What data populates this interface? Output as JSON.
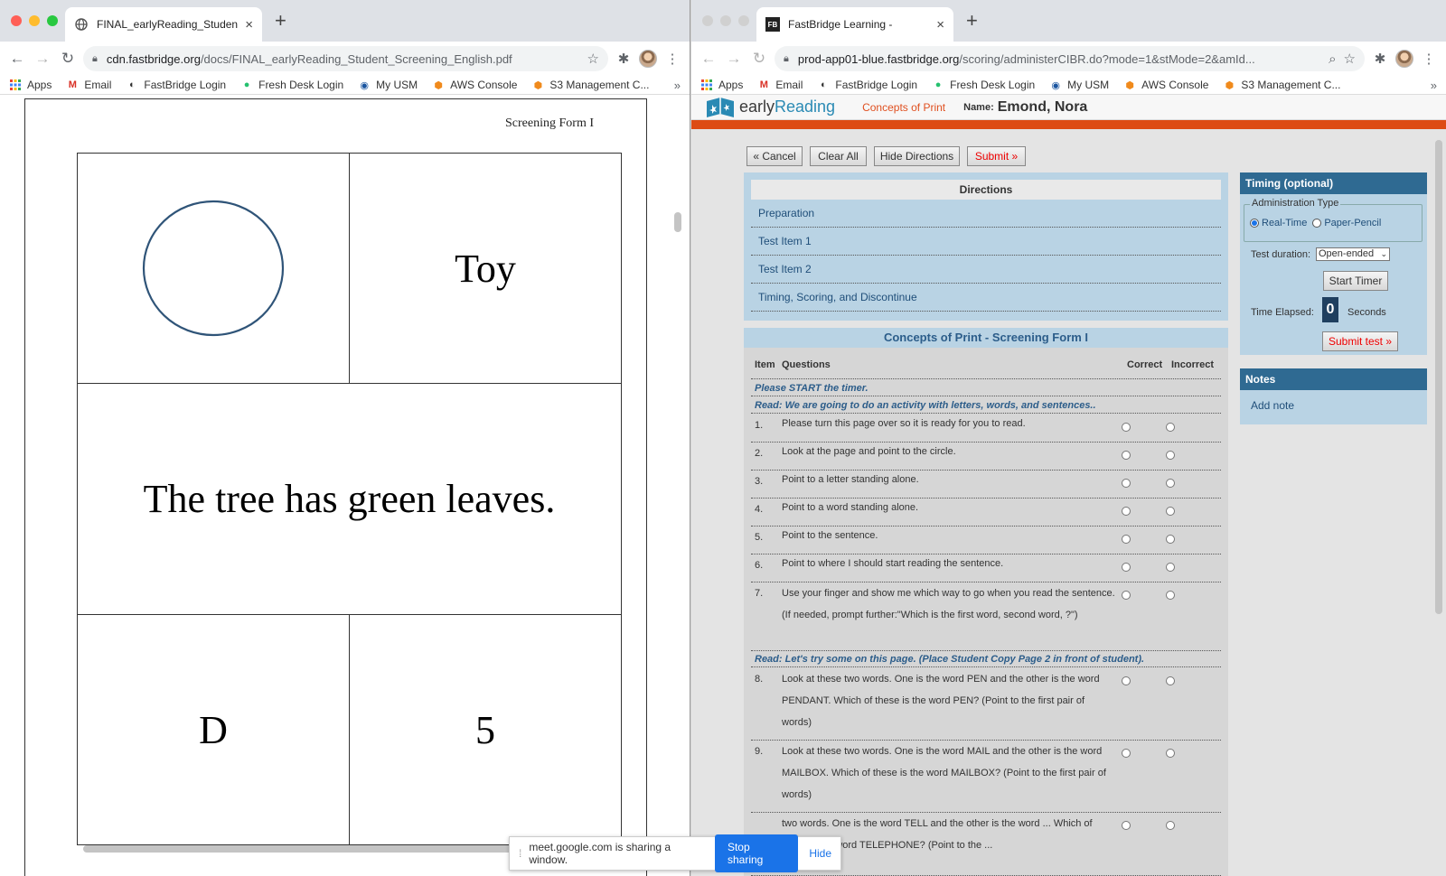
{
  "left_window": {
    "tab_title": "FINAL_earlyReading_Student_S",
    "url_domain": "cdn.fastbridge.org",
    "url_path": "/docs/FINAL_earlyReading_Student_Screening_English.pdf",
    "bookmarks": [
      "Apps",
      "Email",
      "FastBridge Login",
      "Fresh Desk Login",
      "My USM",
      "AWS Console",
      "S3 Management C..."
    ],
    "pdf": {
      "form_label": "Screening Form I",
      "word": "Toy",
      "sentence": "The tree has green leaves.",
      "letter": "D",
      "number": "5"
    }
  },
  "right_window": {
    "tab_title": "FastBridge Learning -",
    "url_domain": "prod-app01-blue.fastbridge.org",
    "url_path": "/scoring/administerCIBR.do?mode=1&stMode=2&amId...",
    "bookmarks": [
      "Apps",
      "Email",
      "FastBridge Login",
      "Fresh Desk Login",
      "My USM",
      "AWS Console",
      "S3 Management C..."
    ]
  },
  "app": {
    "logo_early": "early",
    "logo_reading": "Reading",
    "module": "Concepts of Print",
    "name_label": "Name:",
    "student_name": "Emond, Nora",
    "buttons": {
      "cancel": "« Cancel",
      "clear_all": "Clear All",
      "hide_directions": "Hide Directions",
      "submit": "Submit »"
    },
    "directions": {
      "title": "Directions",
      "items": [
        "Preparation",
        "Test Item 1",
        "Test Item 2",
        "Timing, Scoring, and Discontinue"
      ]
    },
    "questions": {
      "title": "Concepts of Print - Screening Form I",
      "headers": {
        "item": "Item",
        "questions": "Questions",
        "correct": "Correct",
        "incorrect": "Incorrect"
      },
      "read1": "Please START the timer.",
      "read2": "Read: We are going to do an activity with letters, words, and sentences..",
      "read3": "Read: Let's try some on this page. (Place Student Copy Page 2 in front of student).",
      "rows": [
        {
          "num": "1.",
          "text": "Please turn this page over so it is ready for you to read."
        },
        {
          "num": "2.",
          "text": "Look at the page and point to the circle."
        },
        {
          "num": "3.",
          "text": "Point to a letter standing alone."
        },
        {
          "num": "4.",
          "text": "Point to a word standing alone."
        },
        {
          "num": "5.",
          "text": "Point to the sentence."
        },
        {
          "num": "6.",
          "text": "Point to where I should start reading the sentence."
        },
        {
          "num": "7.",
          "text": "Use your finger and show me which way to go when you read the sentence. (If needed, prompt further:\"Which is the first word, second word, ?\")"
        },
        {
          "num": "8.",
          "text": "Look at these two words. One is the word PEN and the other is the word PENDANT. Which of these is the word PEN? (Point to the first pair of words)"
        },
        {
          "num": "9.",
          "text": "Look at these two words. One is the word MAIL and the other is the word MAILBOX. Which of these is the word MAILBOX? (Point to the first pair of words)"
        },
        {
          "num": "",
          "text": "two words. One is the word TELL and the other is the word ... Which of these is the word TELEPHONE? (Point to the ..."
        }
      ]
    },
    "timing": {
      "title": "Timing (optional)",
      "admin_type": "Administration Type",
      "real_time": "Real-Time",
      "paper_pencil": "Paper-Pencil",
      "duration_label": "Test duration:",
      "duration_value": "Open-ended",
      "start_timer": "Start Timer",
      "elapsed_label": "Time Elapsed:",
      "elapsed_value": "0",
      "seconds": "Seconds",
      "submit_test": "Submit test »"
    },
    "notes": {
      "title": "Notes",
      "add_note": "Add note"
    }
  },
  "share_bar": {
    "message": "meet.google.com is sharing a window.",
    "stop": "Stop sharing",
    "hide": "Hide"
  }
}
